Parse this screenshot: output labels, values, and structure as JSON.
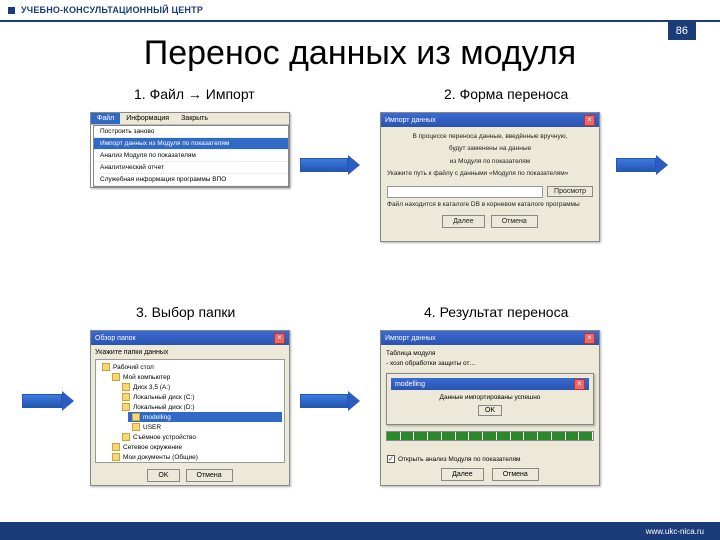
{
  "header": {
    "brand": "УЧЕБНО-КОНСУЛЬТАЦИОННЫЙ ЦЕНТР"
  },
  "page_number": "86",
  "footer_url": "www.ukc-nica.ru",
  "slide_title": "Перенос данных из модуля",
  "captions": {
    "c1": "1. Файл → Импорт",
    "c2": "2. Форма переноса",
    "c3": "3. Выбор папки",
    "c4": "4. Результат переноса"
  },
  "win1": {
    "menubar": {
      "file": "Файл",
      "info": "Информация",
      "close": "Закрыть"
    },
    "items": {
      "i0": "Построить заново",
      "i1": "Импорт данных из Модуля по показателям",
      "i2": "Анализ Модуля по показателям",
      "i3": "Аналитический отчет",
      "i4": "Служебная информация программы ВПО"
    }
  },
  "win2": {
    "title": "Импорт данных",
    "line1": "В процессе переноса данные, введённые вручную,",
    "line2": "будут заменены на данные",
    "line3": "из Модуля по показателям",
    "line4": "Укажите путь к файлу с данными «Модуля по показателям»",
    "line5": "Файл находится в каталоге DB в корневом каталоге программы",
    "browse": "Просмотр",
    "ok": "Далее",
    "cancel": "Отмена"
  },
  "win3": {
    "title": "Обзор папок",
    "sub": "Укажите папки данных",
    "nodes": {
      "n0": "Рабочий стол",
      "n1": "Мой компьютер",
      "n2": "Диск 3,5 (A:)",
      "n3": "Локальный диск (C:)",
      "n4": "Локальный диск (D:)",
      "n5": "modelling",
      "n6": "USER",
      "n7": "Съёмное устройство",
      "n8": "Сетевое окружение",
      "n9": "Мои документы (Общие)"
    },
    "ok": "OK",
    "cancel": "Отмена"
  },
  "win4": {
    "title": "Импорт данных",
    "h": "Таблица модуля",
    "row": "- хозп обработки защиты от…",
    "msg_title": "modelling",
    "msg_text": "Данные импортированы успешно",
    "msg_ok": "OK",
    "check": "Открыть анализ Модуля по показателям",
    "ok": "Далее",
    "cancel": "Отмена"
  }
}
